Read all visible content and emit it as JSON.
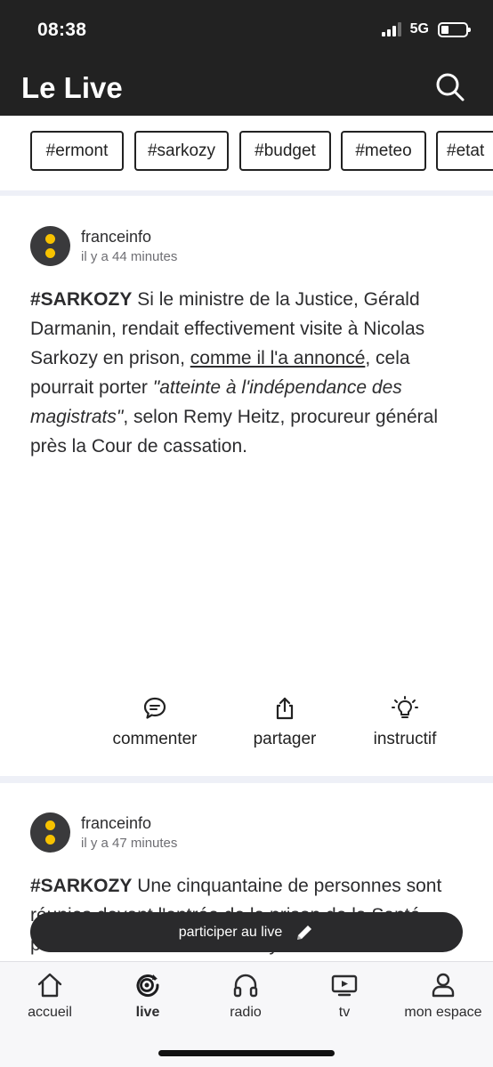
{
  "status": {
    "time": "08:38",
    "network": "5G"
  },
  "header": {
    "title": "Le Live"
  },
  "tags": [
    "#ermont",
    "#sarkozy",
    "#budget",
    "#meteo",
    "#etat"
  ],
  "posts": [
    {
      "author": "franceinfo",
      "time": "il y a 44 minutes",
      "hashtag": "#SARKOZY",
      "text_1": " Si le ministre de la Justice, Gérald Darmanin, rendait effectivement visite à Nicolas Sarkozy en prison, ",
      "link": "comme il l'a annoncé",
      "text_2": ", cela pourrait porter ",
      "quote": "\"atteinte à l'indépendance des magistrats\"",
      "text_3": ", selon Remy Heitz, procureur général près la Cour de cassation."
    },
    {
      "author": "franceinfo",
      "time": "il y a 47 minutes",
      "hashtag": "#SARKOZY",
      "text_1": " Une cinquantaine de personnes sont réunies devant l'entrée de la prison de la Santé, pour soutenir Nicolas Sarkozy."
    }
  ],
  "actions": {
    "comment": "commenter",
    "share": "partager",
    "insightful": "instructif"
  },
  "participate_label": "participer au live",
  "tabs": [
    {
      "label": "accueil",
      "icon": "home-icon"
    },
    {
      "label": "live",
      "icon": "live-icon"
    },
    {
      "label": "radio",
      "icon": "headphones-icon"
    },
    {
      "label": "tv",
      "icon": "tv-icon"
    },
    {
      "label": "mon espace",
      "icon": "user-icon"
    }
  ]
}
